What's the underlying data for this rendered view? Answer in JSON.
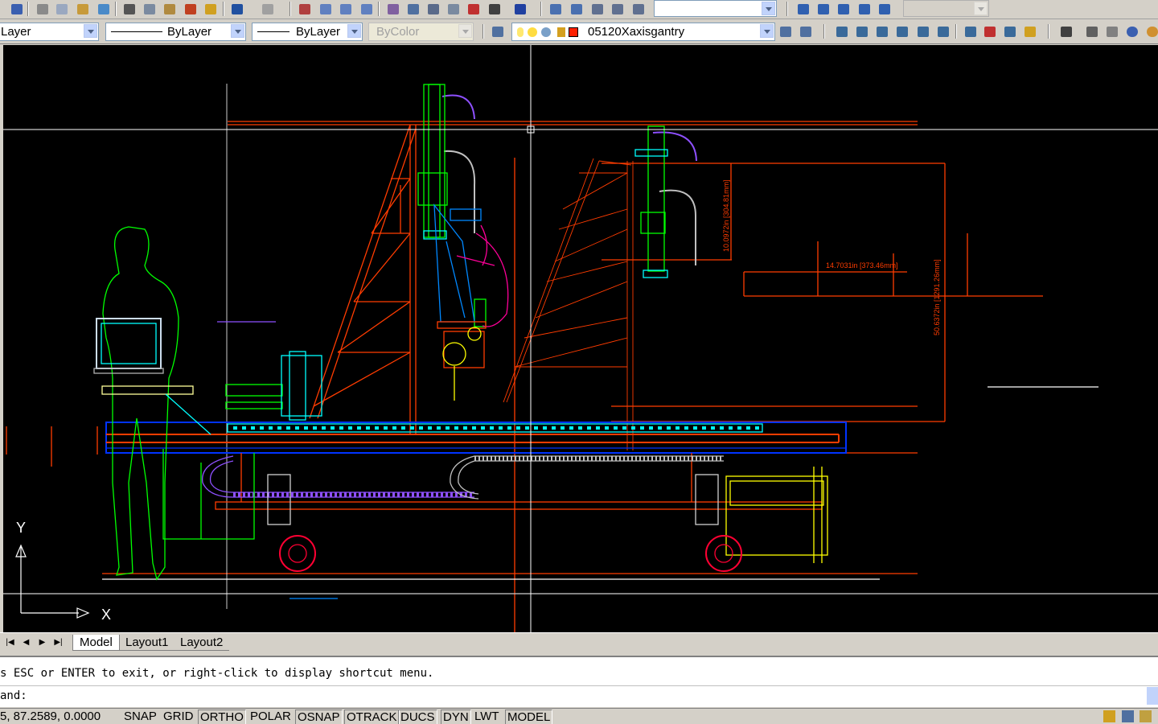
{
  "toolbar2": {
    "layer_dropdown": "Layer",
    "color_dropdown": "ByLayer",
    "linetype_dropdown": "ByLayer",
    "lineweight_dropdown": "ByColor",
    "current_layer": "05120Xaxisgantry"
  },
  "drawing": {
    "dimension_vertical_1": "10.0972in [304.81mm]",
    "dimension_horizontal": "14.7031in [373.46mm]",
    "dimension_vertical_2": "50.6372in [1291.26mm]",
    "ucs_y_label": "Y",
    "ucs_x_label": "X"
  },
  "tabs": [
    "Model",
    "Layout1",
    "Layout2"
  ],
  "command": {
    "history_line": "s ESC or ENTER to exit, or right-click to display shortcut menu.",
    "prompt": "and:"
  },
  "status": {
    "coordinates": "5, 87.2589, 0.0000",
    "toggles": [
      "SNAP",
      "GRID",
      "ORTHO",
      "POLAR",
      "OSNAP",
      "OTRACK",
      "DUCS",
      "DYN",
      "LWT",
      "MODEL"
    ]
  },
  "colors": {
    "frame_orange": "#ff3c00",
    "rail_blue": "#0033ff",
    "figure_green": "#00ff00",
    "carriage_yellow": "#ffff00",
    "wheel_red": "#ff0033",
    "carrier_magenta": "#cc00ff",
    "cyan": "#00ffff",
    "crosshair": "#ffffff"
  }
}
